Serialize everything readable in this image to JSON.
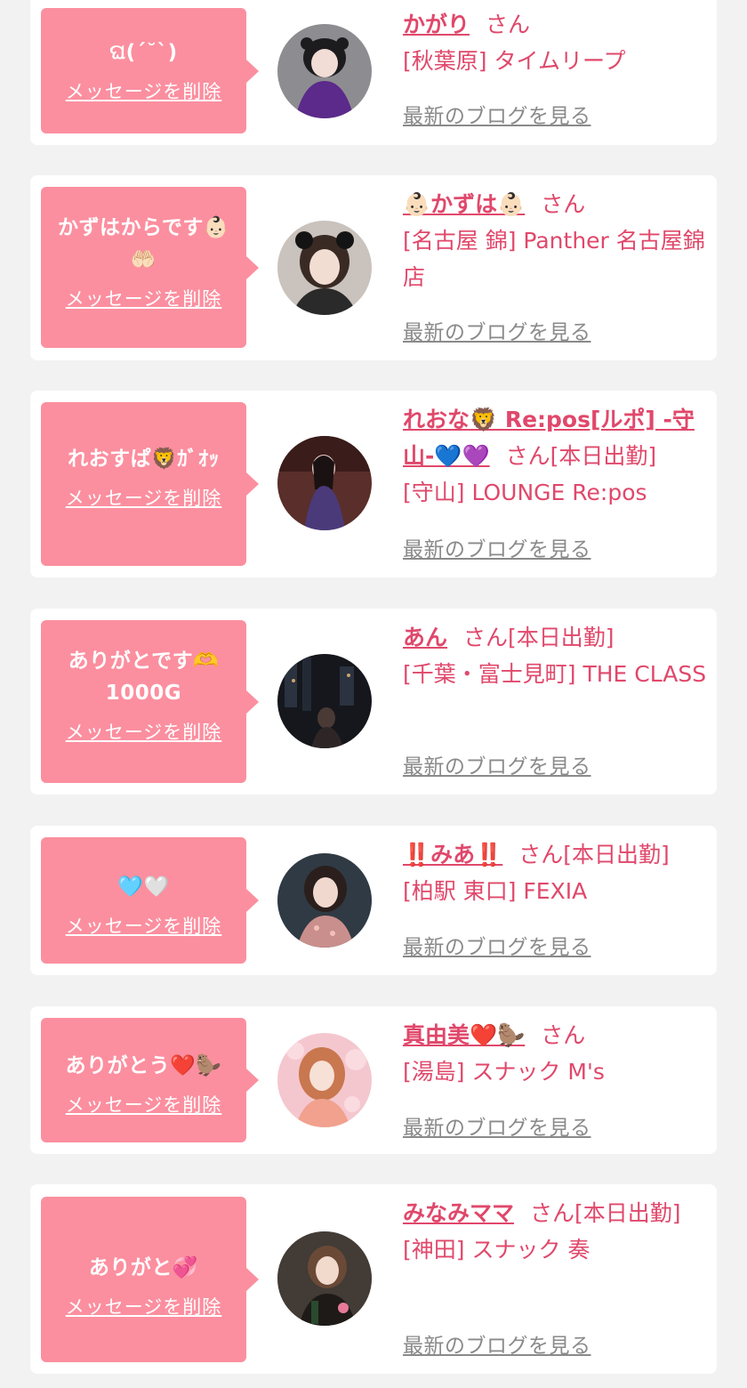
{
  "delete_label": "メッセージを削除",
  "blog_label": "最新のブログを見る",
  "san_label": "さん",
  "accent_color": "#e0486b",
  "bubble_color": "#fb8f9f",
  "messages": [
    {
      "message": "ଘ(ˊ˘ˋ)",
      "name": "かがり",
      "status": "",
      "shop": "[秋葉原] タイムリープ"
    },
    {
      "message": "かずはからです👶🏻🤲🏻",
      "name": "👶🏻かずは👶🏻",
      "status": "",
      "shop": "[名古屋 錦] Panther 名古屋錦店"
    },
    {
      "message": "れおすぱ🦁ｶﾞｵｯ",
      "name": "れおな🦁 Re:pos[ルポ] -守山-💙💜",
      "status": "[本日出勤]",
      "shop": "[守山] LOUNGE Re:pos"
    },
    {
      "message": "ありがとです🫶 1000G",
      "name": "あん",
      "status": "[本日出勤]",
      "shop": "[千葉・富士見町] THE CLASS"
    },
    {
      "message": "🩵🤍",
      "name": "‼️みあ‼️",
      "status": "[本日出勤]",
      "shop": "[柏駅 東口] FEXIA"
    },
    {
      "message": "ありがとう❤️🦫",
      "name": "真由美❤️🦫",
      "status": "",
      "shop": "[湯島] スナック M's"
    },
    {
      "message": "ありがと💞",
      "name": "みなみママ",
      "status": "[本日出勤]",
      "shop": "[神田] スナック 奏"
    }
  ]
}
